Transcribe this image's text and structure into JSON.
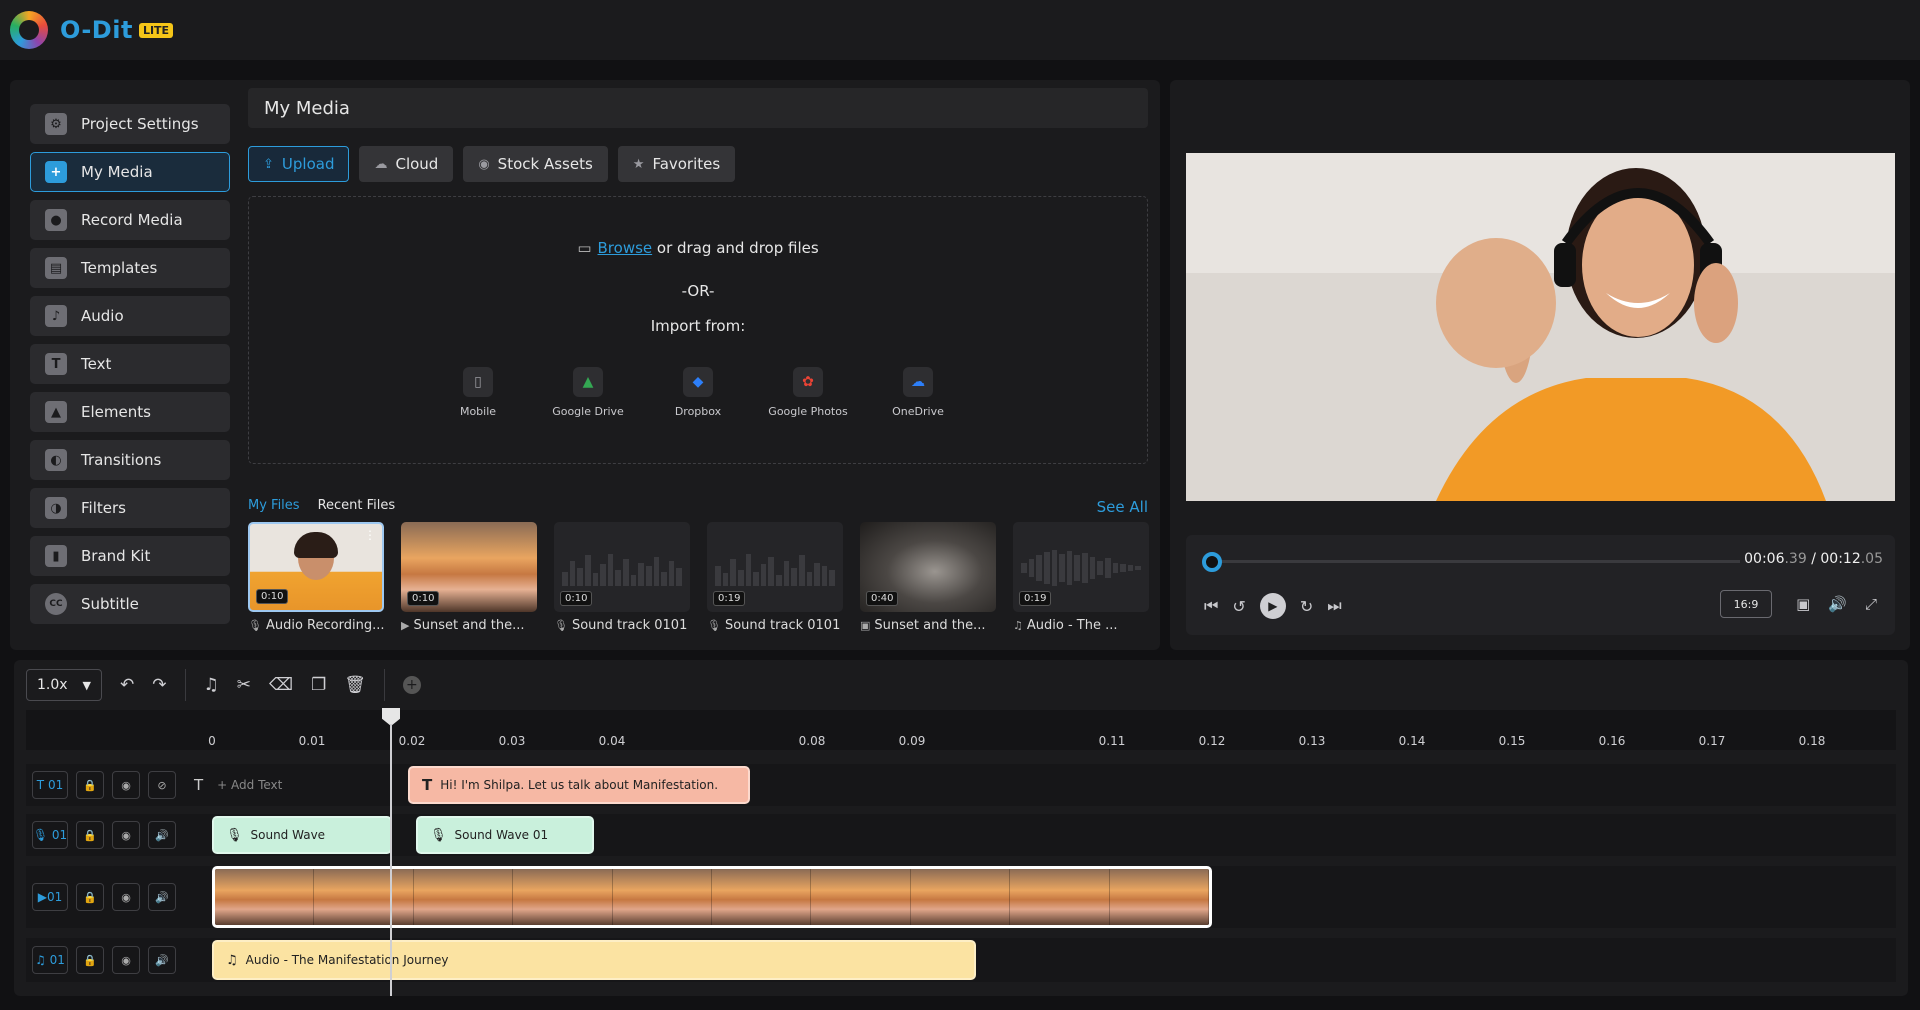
{
  "app": {
    "name": "O-Dit",
    "badge": "LITE"
  },
  "sidebar": {
    "items": [
      {
        "label": "Project Settings",
        "icon": "gear-icon",
        "glyph": "⚙"
      },
      {
        "label": "My Media",
        "icon": "media-add-icon",
        "glyph": "+"
      },
      {
        "label": "Record Media",
        "icon": "record-icon",
        "glyph": "●"
      },
      {
        "label": "Templates",
        "icon": "templates-icon",
        "glyph": "▤"
      },
      {
        "label": "Audio",
        "icon": "music-note-icon",
        "glyph": "♪"
      },
      {
        "label": "Text",
        "icon": "text-icon",
        "glyph": "T"
      },
      {
        "label": "Elements",
        "icon": "shapes-icon",
        "glyph": "▲"
      },
      {
        "label": "Transitions",
        "icon": "transitions-icon",
        "glyph": "◐"
      },
      {
        "label": "Filters",
        "icon": "filters-icon",
        "glyph": "◑"
      },
      {
        "label": "Brand Kit",
        "icon": "brand-kit-icon",
        "glyph": "▮"
      },
      {
        "label": "Subtitle",
        "icon": "cc-icon",
        "glyph": "CC"
      }
    ],
    "active_index": 1
  },
  "media": {
    "title": "My Media",
    "tabs": [
      {
        "label": "Upload",
        "glyph": "⇪"
      },
      {
        "label": "Cloud",
        "glyph": "☁"
      },
      {
        "label": "Stock Assets",
        "glyph": "◉"
      },
      {
        "label": "Favorites",
        "glyph": "★"
      }
    ],
    "dropzone": {
      "browse": "Browse",
      "drag_text": " or drag and drop files",
      "or": "-OR-",
      "import_from": "Import from:",
      "sources": [
        {
          "label": "Mobile",
          "glyph": "▯",
          "color": "#9a9aa0"
        },
        {
          "label": "Google Drive",
          "glyph": "▲",
          "color": "#34a853"
        },
        {
          "label": "Dropbox",
          "glyph": "◆",
          "color": "#2d7ff9"
        },
        {
          "label": "Google Photos",
          "glyph": "✿",
          "color": "#ea4335"
        },
        {
          "label": "OneDrive",
          "glyph": "☁",
          "color": "#2d7ff9"
        }
      ]
    },
    "files_tabs": [
      "My Files",
      "Recent Files"
    ],
    "see_all": "See All",
    "files": [
      {
        "duration": "0:10",
        "label": "Audio Recording...",
        "type_glyph": "🎙"
      },
      {
        "duration": "0:10",
        "label": "Sunset and the...",
        "type_glyph": "▶"
      },
      {
        "duration": "0:10",
        "label": "Sound track 0101",
        "type_glyph": "🎙"
      },
      {
        "duration": "0:19",
        "label": "Sound track 0101",
        "type_glyph": "🎙"
      },
      {
        "duration": "0:40",
        "label": "Sunset and the...",
        "type_glyph": "▣"
      },
      {
        "duration": "0:19",
        "label": "Audio - The ...",
        "type_glyph": "♫"
      }
    ]
  },
  "player": {
    "current": "00:06",
    "current_frac": ".39",
    "sep": " / ",
    "total": "00:12",
    "total_frac": ".05",
    "ratio": "16:9",
    "progress": 0.0
  },
  "timeline": {
    "speed": "1.0x",
    "ticks": [
      "0",
      "0.01",
      "0.02",
      "0.03",
      "0.04",
      "0.08",
      "0.09",
      "0.11",
      "0.12",
      "0.13",
      "0.14",
      "0.15",
      "0.16",
      "0.17",
      "0.18"
    ],
    "tracks": {
      "text": {
        "id": "01",
        "add_label": "+ Add Text",
        "clip": "Hi! I'm Shilpa. Let us talk about Manifestation."
      },
      "voice": {
        "id": "01",
        "clips": [
          "Sound Wave",
          "Sound Wave 01"
        ]
      },
      "video": {
        "id": "01"
      },
      "audio": {
        "id": "01",
        "clip": "Audio - The Manifestation Journey"
      }
    }
  },
  "colors": {
    "accent": "#2d9cdb",
    "text_clip": "#f6b8a4",
    "sound_clip": "#c9f0dc",
    "audio_clip": "#fbe3a2"
  }
}
